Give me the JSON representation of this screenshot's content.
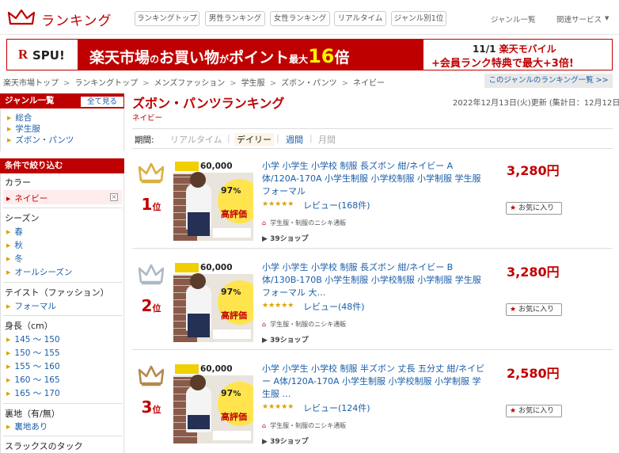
{
  "header": {
    "logo_text": "ランキング",
    "tabs": [
      "ランキングトップ",
      "男性ランキング",
      "女性ランキング",
      "リアルタイム",
      "ジャンル別1位"
    ],
    "links": [
      "ジャンル一覧",
      "関連サービス"
    ],
    "services_arrow": "▼"
  },
  "banner": {
    "spu_r": "R",
    "spu_text": "SPU!",
    "main_pre": "楽天市場",
    "main_small1": "の",
    "main_mid": "お買い物",
    "main_small2": "が",
    "main_point": "ポイント",
    "main_small3": "最大",
    "main_big": "16",
    "main_unit": "倍",
    "r1_date": "11/1",
    "r1_text": "楽天モバイル",
    "r2_text": "+会員ランク特典で最大+3倍!"
  },
  "breadcrumb": [
    "楽天市場トップ",
    "ランキングトップ",
    "メンズファッション",
    "学生服",
    "ズボン・パンツ",
    "ネイビー"
  ],
  "breadcrumb_sep": ">",
  "genre_all_link": "このジャンルのランキング一覧 >>",
  "sidebar": {
    "genre_header": "ジャンル一覧",
    "see_all": "全て見る",
    "genre_items": [
      "総合",
      "学生服",
      "ズボン・パンツ"
    ],
    "filter_header": "条件で絞り込む",
    "color_label": "カラー",
    "color_selected": "ネイビー",
    "season_label": "シーズン",
    "season_items": [
      "春",
      "秋",
      "冬",
      "オールシーズン"
    ],
    "taste_label": "テイスト（ファッション）",
    "taste_items": [
      "フォーマル"
    ],
    "height_label": "身長（cm）",
    "height_items": [
      "145 ～ 150",
      "150 ～ 155",
      "155 ～ 160",
      "160 ～ 165",
      "165 ～ 170"
    ],
    "lining_label": "裏地（有/無）",
    "lining_items": [
      "裏地あり"
    ],
    "slacks_label": "スラックスのタック"
  },
  "main": {
    "title": "ズボン・パンツランキング",
    "subtitle": "ネイビー",
    "updated": "2022年12月13日(火)更新 (集計日：12月12日)",
    "period_label": "期間:",
    "periods": [
      "リアルタイム",
      "デイリー",
      "週間",
      "月間"
    ],
    "period_selected": "デイリー"
  },
  "items": [
    {
      "rank": "1",
      "rank_suffix": "位",
      "name": "小学 小学生 小学校 制服 長ズボン 紺/ネイビー A体/120A-170A 小学生制服 小学校制服 小学制服 学生服 フォーマル",
      "price": "3,280円",
      "stars": "★★★★★",
      "review": "レビュー(168件)",
      "shop": "学生服・制服のニシキ通販",
      "points": "39ショップ",
      "fav": "お気に入り",
      "crown_color": "#d9b03c"
    },
    {
      "rank": "2",
      "rank_suffix": "位",
      "name": "小学 小学生 小学校 制服 長ズボン 紺/ネイビー B体/130B-170B 小学生制服 小学校制服 小学制服 学生服 フォーマル 大…",
      "price": "3,280円",
      "stars": "★★★★★",
      "review": "レビュー(48件)",
      "shop": "学生服・制服のニシキ通販",
      "points": "39ショップ",
      "fav": "お気に入り",
      "crown_color": "#aeb8c4"
    },
    {
      "rank": "3",
      "rank_suffix": "位",
      "name": "小学 小学生 小学校 制服 半ズボン 丈長 五分丈 紺/ネイビー A体/120A-170A 小学生制服 小学校制服 小学制服 学生服 …",
      "price": "2,580円",
      "stars": "★★★★★",
      "review": "レビュー(124件)",
      "shop": "学生服・制服のニシキ通販",
      "points": "39ショップ",
      "fav": "お気に入り",
      "crown_color": "#b5894f"
    }
  ],
  "thumb": {
    "top": "60,000",
    "pct": "97",
    "high": "高評価"
  }
}
